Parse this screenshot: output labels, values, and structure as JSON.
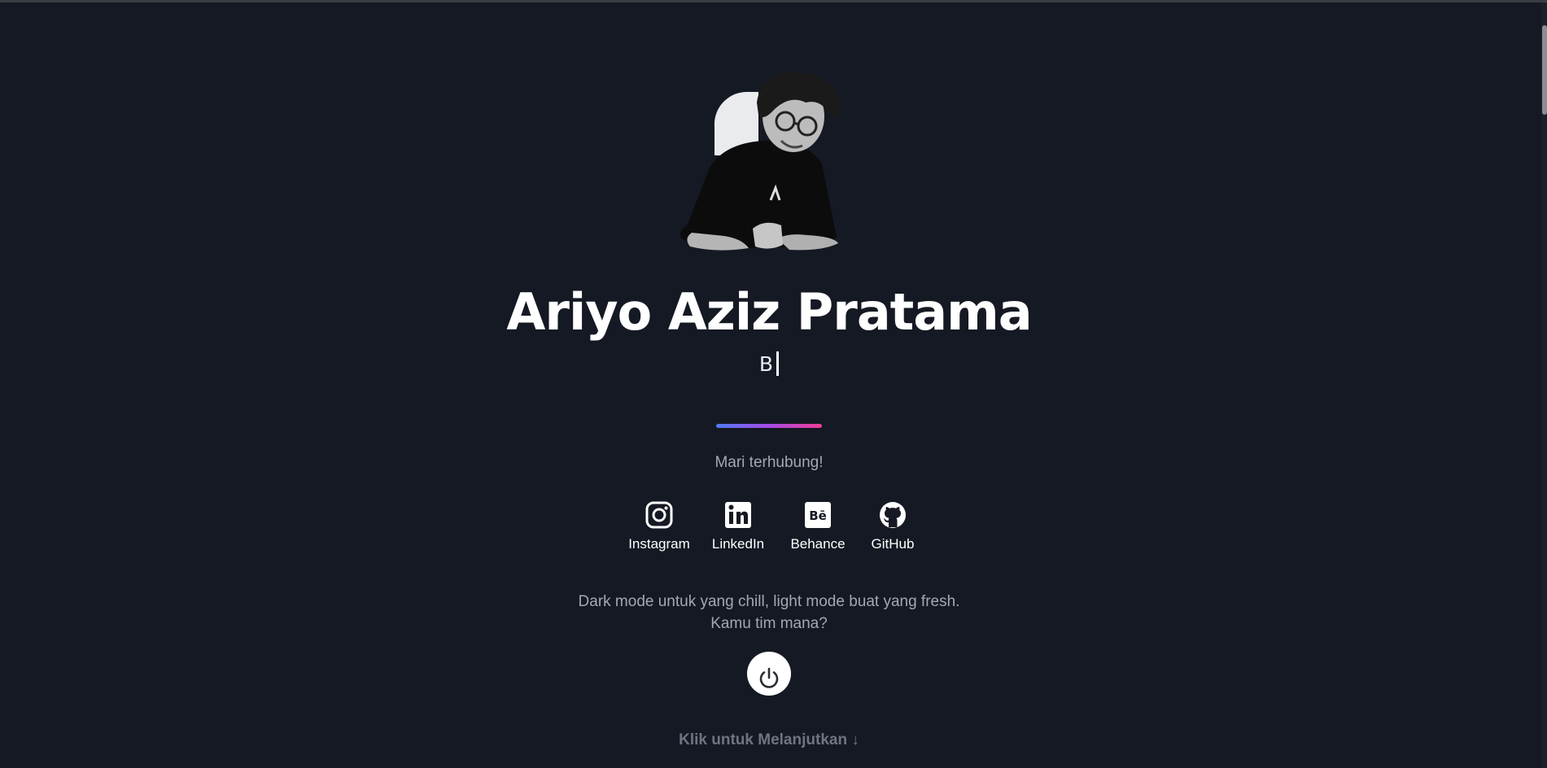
{
  "profile": {
    "name": "Ariyo Aziz Pratama",
    "typed_text": "B",
    "avatar_icon": "person-portrait-photo"
  },
  "connect": {
    "prompt": "Mari terhubung!"
  },
  "socials": [
    {
      "label": "Instagram",
      "icon": "instagram-icon"
    },
    {
      "label": "LinkedIn",
      "icon": "linkedin-icon"
    },
    {
      "label": "Behance",
      "icon": "behance-icon"
    },
    {
      "label": "GitHub",
      "icon": "github-icon"
    }
  ],
  "theme": {
    "tagline": "Dark mode untuk yang chill, light mode buat yang fresh. Kamu tim mana?",
    "toggle_icon": "power-icon"
  },
  "footer": {
    "continue_label": "Klik untuk Melanjutkan ↓"
  },
  "colors": {
    "background": "#151923",
    "muted_text": "#a3a8b3",
    "gradient": [
      "#4f7bf4",
      "#a64ae6",
      "#ee3d93"
    ]
  }
}
